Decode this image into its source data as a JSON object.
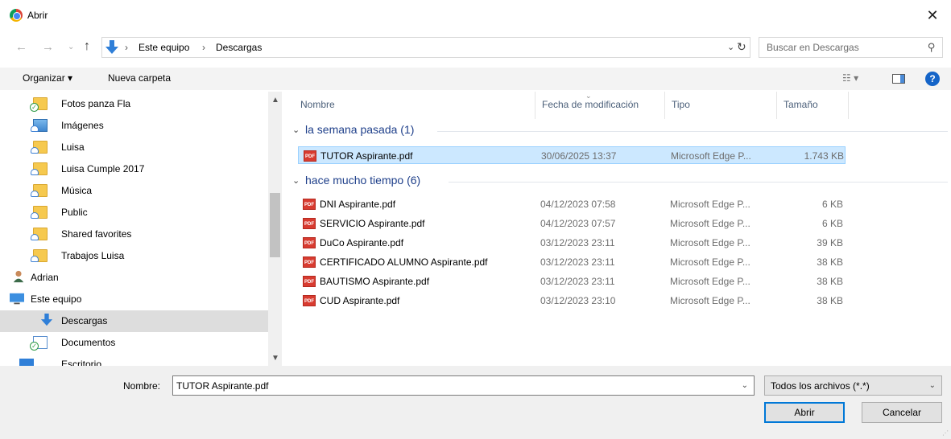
{
  "window": {
    "title": "Abrir",
    "close_glyph": "✕"
  },
  "address": {
    "crumbs": [
      "Este equipo",
      "Descargas"
    ],
    "search_placeholder": "Buscar en Descargas"
  },
  "toolbar": {
    "organize_label": "Organizar ▾",
    "new_folder_label": "Nueva carpeta"
  },
  "sidebar": {
    "items": [
      {
        "label": "Fotos panza Fla",
        "icon": "folder-synced-icon"
      },
      {
        "label": "Imágenes",
        "icon": "pictures-cloud-icon"
      },
      {
        "label": "Luisa",
        "icon": "folder-cloud-icon"
      },
      {
        "label": "Luisa Cumple 2017",
        "icon": "folder-cloud-icon"
      },
      {
        "label": "Música",
        "icon": "folder-cloud-icon"
      },
      {
        "label": "Public",
        "icon": "folder-cloud-icon"
      },
      {
        "label": "Shared favorites",
        "icon": "folder-cloud-icon"
      },
      {
        "label": "Trabajos Luisa",
        "icon": "folder-cloud-icon"
      },
      {
        "label": "Adrian",
        "icon": "user-icon"
      },
      {
        "label": "Este equipo",
        "icon": "computer-icon"
      },
      {
        "label": "Descargas",
        "icon": "downloads-icon",
        "selected": true
      },
      {
        "label": "Documentos",
        "icon": "documents-synced-icon"
      },
      {
        "label": "Escritorio",
        "icon": "desktop-icon"
      }
    ]
  },
  "columns": {
    "name": "Nombre",
    "date": "Fecha de modificación",
    "type": "Tipo",
    "size": "Tamaño"
  },
  "groups": [
    {
      "label": "la semana pasada (1)",
      "files": [
        {
          "name": "TUTOR Aspirante.pdf",
          "date": "30/06/2025 13:37",
          "type": "Microsoft Edge P...",
          "size": "1.743 KB",
          "selected": true
        }
      ]
    },
    {
      "label": "hace mucho tiempo (6)",
      "files": [
        {
          "name": "DNI Aspirante.pdf",
          "date": "04/12/2023 07:58",
          "type": "Microsoft Edge P...",
          "size": "6 KB"
        },
        {
          "name": "SERVICIO Aspirante.pdf",
          "date": "04/12/2023 07:57",
          "type": "Microsoft Edge P...",
          "size": "6 KB"
        },
        {
          "name": "DuCo Aspirante.pdf",
          "date": "03/12/2023 23:11",
          "type": "Microsoft Edge P...",
          "size": "39 KB"
        },
        {
          "name": "CERTIFICADO ALUMNO Aspirante.pdf",
          "date": "03/12/2023 23:11",
          "type": "Microsoft Edge P...",
          "size": "38 KB"
        },
        {
          "name": "BAUTISMO Aspirante.pdf",
          "date": "03/12/2023 23:11",
          "type": "Microsoft Edge P...",
          "size": "38 KB"
        },
        {
          "name": "CUD Aspirante.pdf",
          "date": "03/12/2023 23:10",
          "type": "Microsoft Edge P...",
          "size": "38 KB"
        }
      ]
    }
  ],
  "bottom": {
    "name_label": "Nombre:",
    "name_value": "TUTOR Aspirante.pdf",
    "filter_value": "Todos los archivos (*.*)",
    "open_label": "Abrir",
    "cancel_label": "Cancelar"
  },
  "colors": {
    "selection": "#cce8ff",
    "group_text": "#1e3f8a",
    "accent": "#0078d7"
  }
}
